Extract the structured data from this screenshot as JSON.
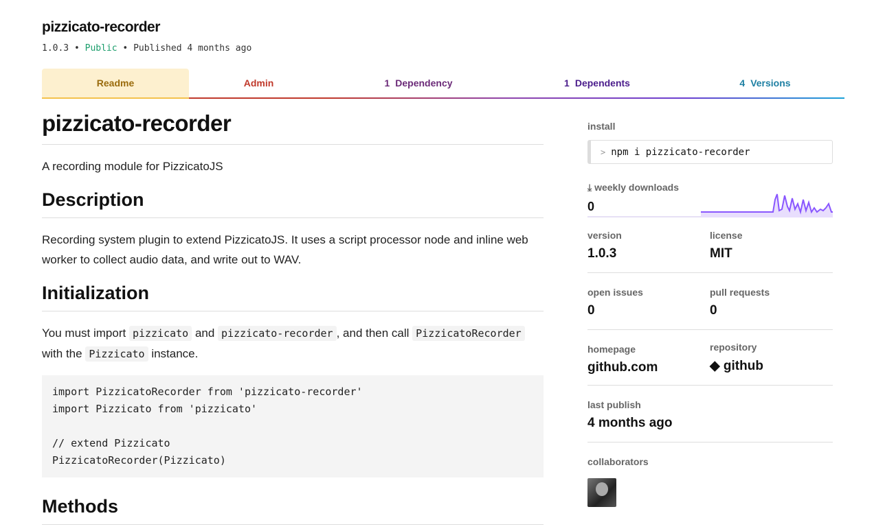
{
  "package": {
    "name": "pizzicato-recorder",
    "version": "1.0.3",
    "visibility": "Public",
    "published": "Published 4 months ago",
    "separator": "•"
  },
  "tabs": {
    "readme": "Readme",
    "admin": "Admin",
    "dependency_count": "1",
    "dependency_label": "Dependency",
    "dependents_count": "1",
    "dependents_label": "Dependents",
    "versions_count": "4",
    "versions_label": "Versions"
  },
  "readme": {
    "title": "pizzicato-recorder",
    "tagline": "A recording module for PizzicatoJS",
    "description_heading": "Description",
    "description_text": "Recording system plugin to extend PizzicatoJS. It uses a script processor node and inline web worker to collect audio data, and write out to WAV.",
    "init_heading": "Initialization",
    "init_text_1": "You must import ",
    "init_code_1": "pizzicato",
    "init_text_2": " and ",
    "init_code_2": "pizzicato-recorder",
    "init_text_3": ", and then call ",
    "init_code_3": "PizzicatoRecorder",
    "init_text_4": " with the ",
    "init_code_4": "Pizzicato",
    "init_text_5": " instance.",
    "code_block": "import PizzicatoRecorder from 'pizzicato-recorder'\nimport Pizzicato from 'pizzicato'\n\n// extend Pizzicato\nPizzicatoRecorder(Pizzicato)",
    "methods_heading": "Methods"
  },
  "sidebar": {
    "install_label": "install",
    "install_command": "npm i pizzicato-recorder",
    "downloads_label": "weekly downloads",
    "downloads_value": "0",
    "version_label": "version",
    "version_value": "1.0.3",
    "license_label": "license",
    "license_value": "MIT",
    "issues_label": "open issues",
    "issues_value": "0",
    "pulls_label": "pull requests",
    "pulls_value": "0",
    "homepage_label": "homepage",
    "homepage_value": "github.com",
    "repository_label": "repository",
    "repository_value": "github",
    "last_publish_label": "last publish",
    "last_publish_value": "4 months ago",
    "collaborators_label": "collaborators"
  },
  "colors": {
    "accent_purple": "#8956ff",
    "public_green": "#1a9d6b"
  }
}
